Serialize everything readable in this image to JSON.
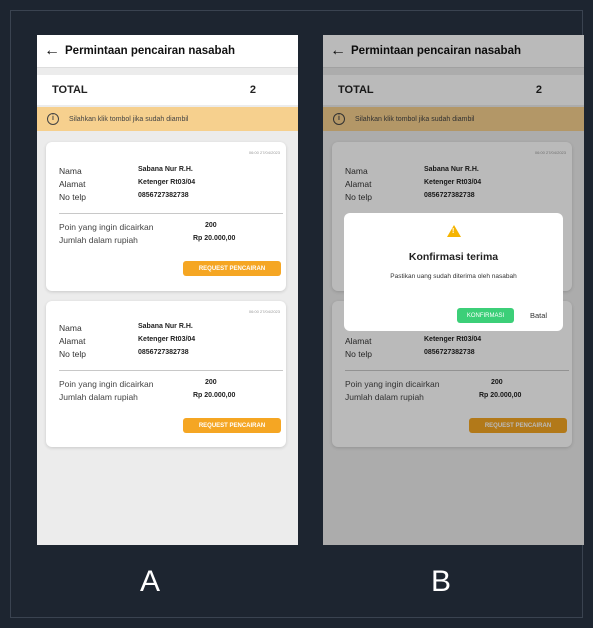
{
  "screen_title": "Permintaan pencairan nasabah",
  "total": {
    "label": "TOTAL",
    "value": "2"
  },
  "info": {
    "text": "Silahkan klik tombol jika sudah diambil"
  },
  "cards": [
    {
      "date": "06:00 27/04/2023",
      "nama_label": "Nama",
      "nama": "Sabana Nur R.H.",
      "alamat_label": "Alamat",
      "alamat": "Ketenger Rt03/04",
      "telp_label": "No telp",
      "telp": "0856727382738",
      "poin_label": "Poin yang ingin dicairkan",
      "poin": "200",
      "rupiah_label": "Jumlah dalam rupiah",
      "rupiah": "Rp 20.000,00",
      "button": "REQUEST PENCAIRAN"
    },
    {
      "date": "06:00 27/04/2023",
      "nama_label": "Nama",
      "nama": "Sabana Nur R.H.",
      "alamat_label": "Alamat",
      "alamat": "Ketenger Rt03/04",
      "telp_label": "No telp",
      "telp": "0856727382738",
      "poin_label": "Poin yang ingin dicairkan",
      "poin": "200",
      "rupiah_label": "Jumlah dalam rupiah",
      "rupiah": "Rp 20.000,00",
      "button": "REQUEST PENCAIRAN"
    }
  ],
  "dialog": {
    "title": "Konfirmasi terima",
    "message": "Pastikan uang sudah diterima oleh nasabah",
    "confirm": "KONFIRMASI",
    "cancel": "Batal"
  },
  "captions": {
    "a": "A",
    "b": "B"
  },
  "icons": {
    "back": "arrow-left-icon",
    "info": "info-icon",
    "warning": "warning-icon"
  },
  "colors": {
    "accent": "#f5a623",
    "info_bg": "#f6d08e",
    "confirm": "#3ccf78",
    "background": "#1d2530"
  }
}
